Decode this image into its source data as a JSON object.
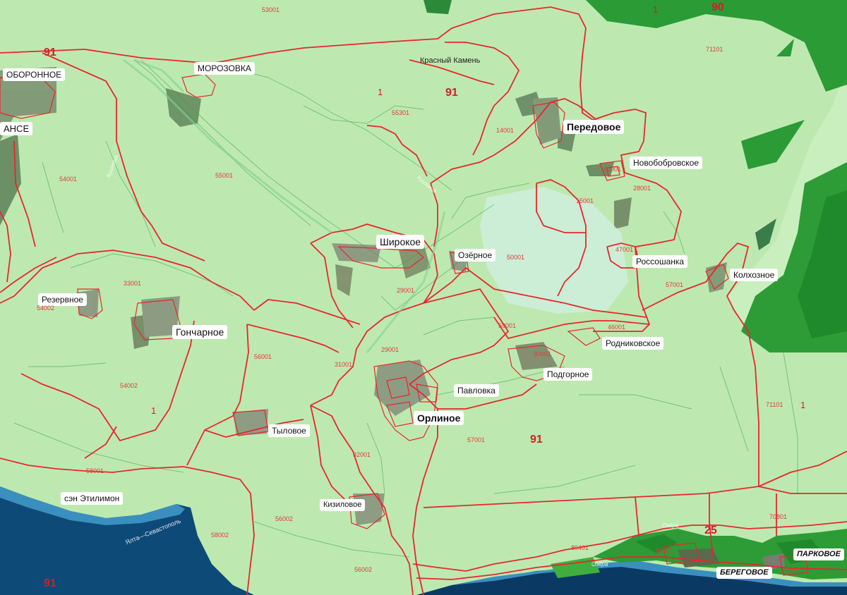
{
  "colors": {
    "parcel_fill": "#bde9b0",
    "boundary_line": "#e8262e",
    "sea_dark": "#0a3a63",
    "sea_light": "#3b8fbf",
    "forest_dark": "#1f8a2b",
    "forest_light": "#3fae3f",
    "label_bg": "#ffffff",
    "code_text": "#e23b3b"
  },
  "settlements": {
    "oboronnoe": "ОБОРОННОЕ",
    "morozovka": "МОРОЗОВКА",
    "krasny_kamen": "Красный Камень",
    "peredovoe": "Передовое",
    "novobobrovskoe": "Новобобровское",
    "shirokoe": "Широкое",
    "ozernoe": "Озёрное",
    "rossoshanka": "Россошанка",
    "kolkhoznoe": "Колхозное",
    "rezervnoe": "Резервное",
    "goncharnoe": "Гончарное",
    "rodnikovskoe": "Родниковское",
    "podgornoe": "Подгорное",
    "pavlovka": "Павловка",
    "orlinoe": "Орлиное",
    "tylovoe": "Тыловое",
    "kizilovoe": "Кизиловое",
    "sen_etilimon": "сэн Этилимон",
    "beregovoe": "БЕРЕГОВОЕ",
    "parkovoe": "ПАРКОВОЕ",
    "partial_left": "АНСЕ"
  },
  "zone_numbers": {
    "z91_top": "91",
    "z91_left": "91",
    "z91_center": "91",
    "z91_bottom": "91",
    "z90": "90",
    "z25": "25",
    "z1_a": "1",
    "z1_b": "1",
    "z1_c": "1",
    "z1_d": "1"
  },
  "parcel_codes": {
    "c53001": "53001",
    "c55301": "55301",
    "c14001": "14001",
    "c54001": "54001",
    "c55001": "55001",
    "c71101_top": "71101",
    "c28001": "28001",
    "c15001": "15001",
    "c47001": "47001",
    "c50001": "50001",
    "c57001": "57001",
    "c33001": "33001",
    "c54002_small": "54002",
    "c29001_a": "29001",
    "c29001_b": "29001",
    "c56001": "56001",
    "c31001": "31001",
    "c46001": "46001",
    "c50001_b": "50001",
    "c30001": "30001",
    "c54002": "54002",
    "c57001_b": "57001",
    "c71101": "71101",
    "c58001": "58001",
    "c32001": "32001",
    "c56002_a": "56002",
    "c56002_b": "56002",
    "c58002": "58002",
    "c70801": "70801",
    "c80401": "80401",
    "c80201": "80201",
    "c40001": "40001",
    "c70401": "70401"
  },
  "road_labels": {
    "r1": "Кушница",
    "r2": "Кушница",
    "r3": "Ялта—Севастополь",
    "r4": "Озёра",
    "r5": "Озёра"
  }
}
